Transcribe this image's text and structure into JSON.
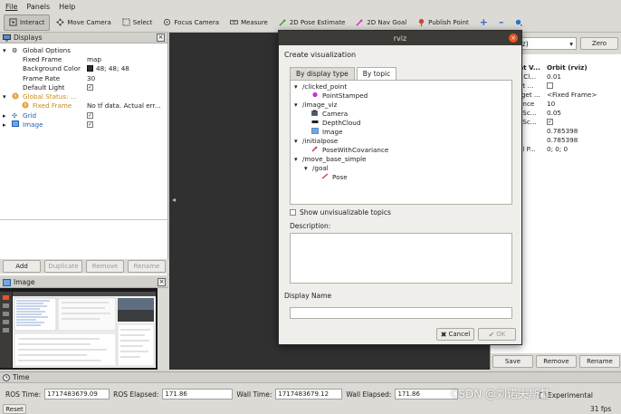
{
  "menu": [
    "File",
    "Panels",
    "Help"
  ],
  "toolbar": {
    "tools": [
      {
        "label": "Interact",
        "icon": "interact-icon"
      },
      {
        "label": "Move Camera",
        "icon": "move-camera-icon"
      },
      {
        "label": "Select",
        "icon": "select-icon"
      },
      {
        "label": "Focus Camera",
        "icon": "focus-camera-icon"
      },
      {
        "label": "Measure",
        "icon": "measure-icon"
      },
      {
        "label": "2D Pose Estimate",
        "icon": "pose-estimate-icon"
      },
      {
        "label": "2D Nav Goal",
        "icon": "nav-goal-icon"
      },
      {
        "label": "Publish Point",
        "icon": "publish-point-icon"
      }
    ]
  },
  "displays": {
    "title": "Displays",
    "global_options": "Global Options",
    "fixed_frame_label": "Fixed Frame",
    "fixed_frame_value": "map",
    "background_label": "Background Color",
    "background_value": "48; 48; 48",
    "frame_rate_label": "Frame Rate",
    "frame_rate_value": "30",
    "default_light_label": "Default Light",
    "global_status": "Global Status: ...",
    "status_fixed_frame": "Fixed Frame",
    "status_fixed_frame_value": "No tf data.  Actual err...",
    "grid": "Grid",
    "image": "Image",
    "buttons": {
      "add": "Add",
      "duplicate": "Duplicate",
      "remove": "Remove",
      "rename": "Rename"
    }
  },
  "image_panel": {
    "title": "Image"
  },
  "dialog": {
    "title": "rviz",
    "heading": "Create visualization",
    "tab_display_type": "By display type",
    "tab_topic": "By topic",
    "topics": [
      {
        "label": "/clicked_point",
        "level": 0,
        "expander": true
      },
      {
        "label": "PointStamped",
        "level": 1,
        "icon": "point-stamped-icon"
      },
      {
        "label": "/image_viz",
        "level": 0,
        "expander": true
      },
      {
        "label": "Camera",
        "level": 1,
        "icon": "camera-icon"
      },
      {
        "label": "DepthCloud",
        "level": 1,
        "icon": "depthcloud-icon"
      },
      {
        "label": "Image",
        "level": 1,
        "icon": "image-icon"
      },
      {
        "label": "/initialpose",
        "level": 0,
        "expander": true
      },
      {
        "label": "PoseWithCovariance",
        "level": 1,
        "icon": "pose-covariance-icon"
      },
      {
        "label": "/move_base_simple",
        "level": 0,
        "expander": true
      },
      {
        "label": "/goal",
        "level": 1,
        "expander": true
      },
      {
        "label": "Pose",
        "level": 2,
        "icon": "pose-icon"
      }
    ],
    "show_unvisualizable": "Show unvisualizable topics",
    "description_label": "Description:",
    "display_name_label": "Display Name",
    "display_name_value": "",
    "cancel": "Cancel",
    "ok": "OK"
  },
  "views": {
    "type_value": "rbit (rviz)",
    "zero": "Zero",
    "header_key": "nt V...",
    "header_value": "Orbit (rviz)",
    "rows": [
      {
        "k": "r Cl...",
        "v": "0.01"
      },
      {
        "k": "et ...",
        "v": ""
      },
      {
        "k": "rget ...",
        "v": "<Fixed Frame>"
      },
      {
        "k": "ance",
        "v": "10"
      },
      {
        "k": "l Sc...",
        "v": "0.05"
      },
      {
        "k": "l Sc...",
        "v": ""
      },
      {
        "k": "",
        "v": "0.785398"
      },
      {
        "k": "",
        "v": "0.785398"
      },
      {
        "k": "al P...",
        "v": "0; 0; 0"
      }
    ],
    "save": "Save",
    "remove": "Remove",
    "rename": "Rename"
  },
  "time": {
    "title": "Time",
    "ros_time_label": "ROS Time:",
    "ros_time": "1717483679.09",
    "ros_elapsed_label": "ROS Elapsed:",
    "ros_elapsed": "171.86",
    "wall_time_label": "Wall Time:",
    "wall_time": "1717483679.12",
    "wall_elapsed_label": "Wall Elapsed:",
    "wall_elapsed": "171.86",
    "experimental": "Experimental",
    "fps": "31 fps",
    "reset": "Reset"
  },
  "watermark": "CSDN @刘诺夫斯基",
  "colors": {
    "accent": "#e95420",
    "warning": "#e8a33d",
    "viewport": "#303030",
    "link": "#1e5fb8"
  }
}
